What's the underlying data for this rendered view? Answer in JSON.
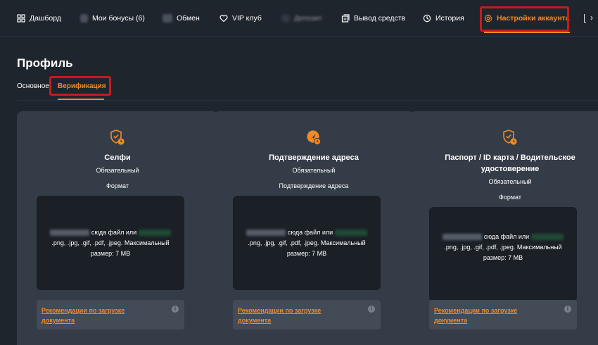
{
  "nav": {
    "items": [
      {
        "label": "Дашборд",
        "icon": "dashboard-icon"
      },
      {
        "label": "Мои бонусы (6)",
        "icon": "bonus-icon"
      },
      {
        "label": "Обмен",
        "icon": "exchange-icon"
      },
      {
        "label": "VIP клуб",
        "icon": "heart-icon"
      },
      {
        "label": "Депозит",
        "icon": "deposit-icon"
      },
      {
        "label": "Вывод средств",
        "icon": "withdraw-icon"
      },
      {
        "label": "История",
        "icon": "history-icon"
      },
      {
        "label": "Настройки аккаунта",
        "icon": "gear-icon"
      }
    ],
    "active_index": 7,
    "more_glyph": "›"
  },
  "page": {
    "title": "Профиль",
    "tabs": [
      "Основное",
      "Верификация"
    ],
    "active_tab": 1
  },
  "cards": [
    {
      "title": "Селфи",
      "required": "Обязательный",
      "format_label": "Формат",
      "upload_text_1": "сюда файл или",
      "upload_text_2": ".png, .jpg, .gif, .pdf, .jpeg. Максимальный",
      "upload_text_3": "размер: 7 MB",
      "recommendation": "Рекомендации по загрузке документа",
      "icon": "shield-clock-icon"
    },
    {
      "title": "Подтверждение адреса",
      "required": "Обязательный",
      "format_label": "Подтверждение адреса",
      "upload_text_1": "сюда файл или",
      "upload_text_2": ".png, .jpg, .gif, .pdf, .jpeg. Максимальный",
      "upload_text_3": "размер: 7 MB",
      "recommendation": "Рекомендации по загрузке документа",
      "icon": "location-clock-icon"
    },
    {
      "title": "Паспорт / ID карта / Водительское удостоверение",
      "required": "Обязательный",
      "format_label": "Формат",
      "upload_text_1": "сюда файл или",
      "upload_text_2": ".png, .jpg, .gif, .pdf, .jpeg. Максимальный",
      "upload_text_3": "размер: 7 MB",
      "recommendation": "Рекомендации по загрузке документа",
      "icon": "shield-clock-icon"
    }
  ],
  "colors": {
    "accent": "#f08a24",
    "background": "#1f252d",
    "card": "#343c47",
    "dropzone": "#1b2027",
    "highlight_box": "#c41c1c"
  }
}
